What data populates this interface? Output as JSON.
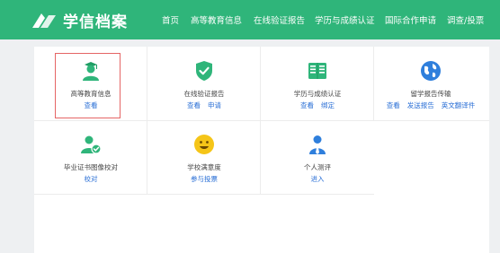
{
  "header": {
    "logo_text": "学信档案",
    "nav": [
      "首页",
      "高等教育信息",
      "在线验证报告",
      "学历与成绩认证",
      "国际合作申请",
      "调查/投票"
    ]
  },
  "colors": {
    "brand": "#2fb57a",
    "link": "#2a6fd6",
    "highlight_border": "#e56565"
  },
  "cards": [
    {
      "title": "高等教育信息",
      "links": [
        "查看"
      ],
      "icon": "graduate-person-icon",
      "selected": true
    },
    {
      "title": "在线验证报告",
      "links": [
        "查看",
        "申请"
      ],
      "icon": "shield-check-icon"
    },
    {
      "title": "学历与成绩认证",
      "links": [
        "查看",
        "绑定"
      ],
      "icon": "open-book-icon"
    },
    {
      "title": "留学报告传输",
      "links": [
        "查看",
        "发送报告",
        "英文翻译件"
      ],
      "icon": "globe-icon"
    },
    {
      "title": "毕业证书图像校对",
      "links": [
        "校对"
      ],
      "icon": "person-check-icon"
    },
    {
      "title": "学校满意度",
      "links": [
        "参与投票"
      ],
      "icon": "smiley-face-icon"
    },
    {
      "title": "个人测评",
      "links": [
        "进入"
      ],
      "icon": "person-tie-icon"
    }
  ]
}
